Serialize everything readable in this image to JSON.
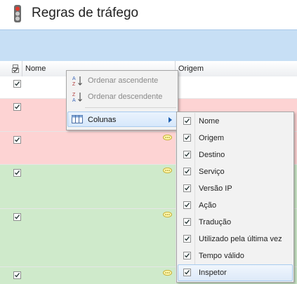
{
  "window": {
    "title": "Regras de tráfego",
    "icon": "traffic-light-icon"
  },
  "grid": {
    "columns": [
      {
        "id": "select",
        "label": ""
      },
      {
        "id": "nome",
        "label": "Nome"
      },
      {
        "id": "origem",
        "label": "Origem"
      }
    ],
    "rows": [
      {
        "status": "neutral",
        "checked": true
      },
      {
        "status": "deny",
        "checked": true
      },
      {
        "status": "deny",
        "checked": true,
        "comment": true
      },
      {
        "status": "allow",
        "checked": true,
        "comment": true
      },
      {
        "status": "allow",
        "checked": true,
        "comment": true
      },
      {
        "status": "allow",
        "checked": true,
        "comment": true
      }
    ],
    "colors": {
      "deny": "#fdd3d3",
      "allow": "#cfeacb",
      "neutral": "#ffffff"
    }
  },
  "context_menu": {
    "items": [
      {
        "label": "Ordenar ascendente",
        "icon": "sort-ascending-icon",
        "enabled": false
      },
      {
        "label": "Ordenar descendente",
        "icon": "sort-descending-icon",
        "enabled": false
      },
      {
        "label": "Colunas",
        "icon": "columns-icon",
        "enabled": true,
        "highlighted": true,
        "submenu": true
      }
    ]
  },
  "columns_submenu": {
    "items": [
      {
        "label": "Nome",
        "checked": true
      },
      {
        "label": "Origem",
        "checked": true
      },
      {
        "label": "Destino",
        "checked": true
      },
      {
        "label": "Serviço",
        "checked": true
      },
      {
        "label": "Versão IP",
        "checked": true
      },
      {
        "label": "Ação",
        "checked": true
      },
      {
        "label": "Tradução",
        "checked": true
      },
      {
        "label": "Utilizado pela última vez",
        "checked": true
      },
      {
        "label": "Tempo válido",
        "checked": true
      },
      {
        "label": "Inspetor",
        "checked": true,
        "highlighted": true
      }
    ]
  }
}
